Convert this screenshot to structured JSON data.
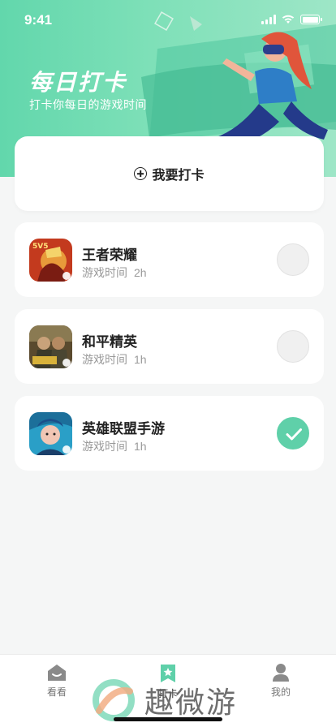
{
  "status": {
    "time": "9:41"
  },
  "header": {
    "title": "每日打卡",
    "subtitle": "打卡你每日的游戏时间"
  },
  "checkin_button": {
    "label": "我要打卡"
  },
  "games": [
    {
      "name": "王者荣耀",
      "time_label": "游戏时间",
      "hours": "2h",
      "checked": false,
      "icon": "honor-of-kings-icon"
    },
    {
      "name": "和平精英",
      "time_label": "游戏时间",
      "hours": "1h",
      "checked": false,
      "icon": "game-for-peace-icon"
    },
    {
      "name": "英雄联盟手游",
      "time_label": "游戏时间",
      "hours": "1h",
      "checked": true,
      "icon": "lol-wild-rift-icon"
    }
  ],
  "tabbar": {
    "items": [
      {
        "label": "看看",
        "icon": "house-icon",
        "active": false
      },
      {
        "label": "打卡",
        "icon": "bookmark-star-icon",
        "active": true
      },
      {
        "label": "我的",
        "icon": "person-icon",
        "active": false
      }
    ]
  },
  "watermark": {
    "text": "趣微游"
  },
  "colors": {
    "accent": "#5fd0a9",
    "hero": "#6fdcb1"
  }
}
